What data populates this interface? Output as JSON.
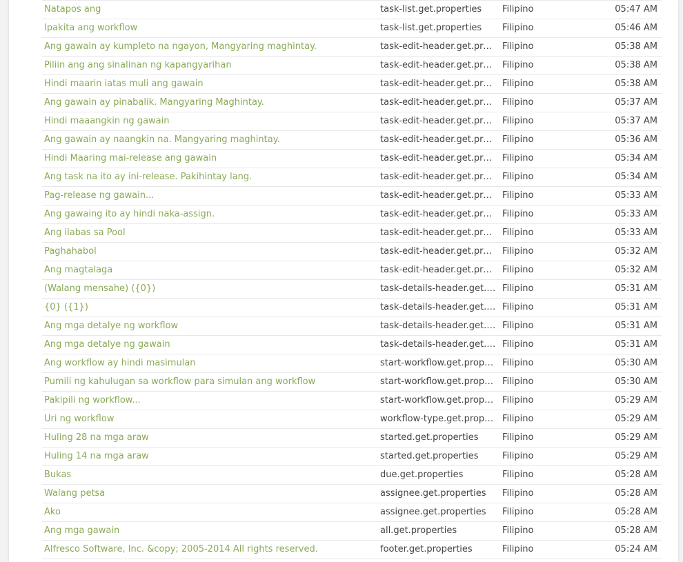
{
  "rows": [
    {
      "message": "Natapos ang",
      "key": "task-list.get.properties",
      "language": "Filipino",
      "time": "05:47 AM"
    },
    {
      "message": "Ipakita ang workflow",
      "key": "task-list.get.properties",
      "language": "Filipino",
      "time": "05:46 AM"
    },
    {
      "message": "Ang gawain ay kumpleto na ngayon, Mangyaring maghintay.",
      "key": "task-edit-header.get.properties",
      "language": "Filipino",
      "time": "05:38 AM"
    },
    {
      "message": "Piliin ang ang sinalinan ng kapangyarihan",
      "key": "task-edit-header.get.properties",
      "language": "Filipino",
      "time": "05:38 AM"
    },
    {
      "message": "Hindi maarin iatas muli ang gawain",
      "key": "task-edit-header.get.properties",
      "language": "Filipino",
      "time": "05:38 AM"
    },
    {
      "message": "Ang gawain ay pinabalik. Mangyaring Maghintay.",
      "key": "task-edit-header.get.properties",
      "language": "Filipino",
      "time": "05:37 AM"
    },
    {
      "message": "Hindi maaangkin ng gawain",
      "key": "task-edit-header.get.properties",
      "language": "Filipino",
      "time": "05:37 AM"
    },
    {
      "message": "Ang gawain ay naangkin na. Mangyaring maghintay.",
      "key": "task-edit-header.get.properties",
      "language": "Filipino",
      "time": "05:36 AM"
    },
    {
      "message": "Hindi Maaring mai-release ang gawain",
      "key": "task-edit-header.get.properties",
      "language": "Filipino",
      "time": "05:34 AM"
    },
    {
      "message": "Ang task na ito ay ini-release. Pakihintay lang.",
      "key": "task-edit-header.get.properties",
      "language": "Filipino",
      "time": "05:34 AM"
    },
    {
      "message": "Pag-release ng gawain...",
      "key": "task-edit-header.get.properties",
      "language": "Filipino",
      "time": "05:33 AM"
    },
    {
      "message": "Ang gawaing ito ay hindi naka-assign.",
      "key": "task-edit-header.get.properties",
      "language": "Filipino",
      "time": "05:33 AM"
    },
    {
      "message": "Ang ilabas sa Pool",
      "key": "task-edit-header.get.properties",
      "language": "Filipino",
      "time": "05:33 AM"
    },
    {
      "message": "Paghahabol",
      "key": "task-edit-header.get.properties",
      "language": "Filipino",
      "time": "05:32 AM"
    },
    {
      "message": "Ang magtalaga",
      "key": "task-edit-header.get.properties",
      "language": "Filipino",
      "time": "05:32 AM"
    },
    {
      "message": "(Walang mensahe) ({0})",
      "key": "task-details-header.get.properties",
      "language": "Filipino",
      "time": "05:31 AM"
    },
    {
      "message": "{0} ({1})",
      "key": "task-details-header.get.properties",
      "language": "Filipino",
      "time": "05:31 AM"
    },
    {
      "message": "Ang mga detalye ng workflow",
      "key": "task-details-header.get.properties",
      "language": "Filipino",
      "time": "05:31 AM"
    },
    {
      "message": "Ang mga detalye ng gawain",
      "key": "task-details-header.get.properties",
      "language": "Filipino",
      "time": "05:31 AM"
    },
    {
      "message": "Ang workflow ay hindi masimulan",
      "key": "start-workflow.get.properties",
      "language": "Filipino",
      "time": "05:30 AM"
    },
    {
      "message": "Pumili ng kahulugan sa workflow para simulan ang workflow",
      "key": "start-workflow.get.properties",
      "language": "Filipino",
      "time": "05:30 AM"
    },
    {
      "message": "Pakipili ng workflow...",
      "key": "start-workflow.get.properties",
      "language": "Filipino",
      "time": "05:29 AM"
    },
    {
      "message": "Uri ng workflow",
      "key": "workflow-type.get.properties",
      "language": "Filipino",
      "time": "05:29 AM"
    },
    {
      "message": "Huling 28 na mga araw",
      "key": "started.get.properties",
      "language": "Filipino",
      "time": "05:29 AM"
    },
    {
      "message": "Huling 14 na mga araw",
      "key": "started.get.properties",
      "language": "Filipino",
      "time": "05:29 AM"
    },
    {
      "message": "Bukas",
      "key": "due.get.properties",
      "language": "Filipino",
      "time": "05:28 AM"
    },
    {
      "message": "Walang petsa",
      "key": "assignee.get.properties",
      "language": "Filipino",
      "time": "05:28 AM"
    },
    {
      "message": "Ako",
      "key": "assignee.get.properties",
      "language": "Filipino",
      "time": "05:28 AM"
    },
    {
      "message": "Ang mga gawain",
      "key": "all.get.properties",
      "language": "Filipino",
      "time": "05:28 AM"
    },
    {
      "message": "Alfresco Software, Inc. &copy; 2005-2014 All rights reserved.",
      "key": "footer.get.properties",
      "language": "Filipino",
      "time": "05:24 AM"
    }
  ]
}
